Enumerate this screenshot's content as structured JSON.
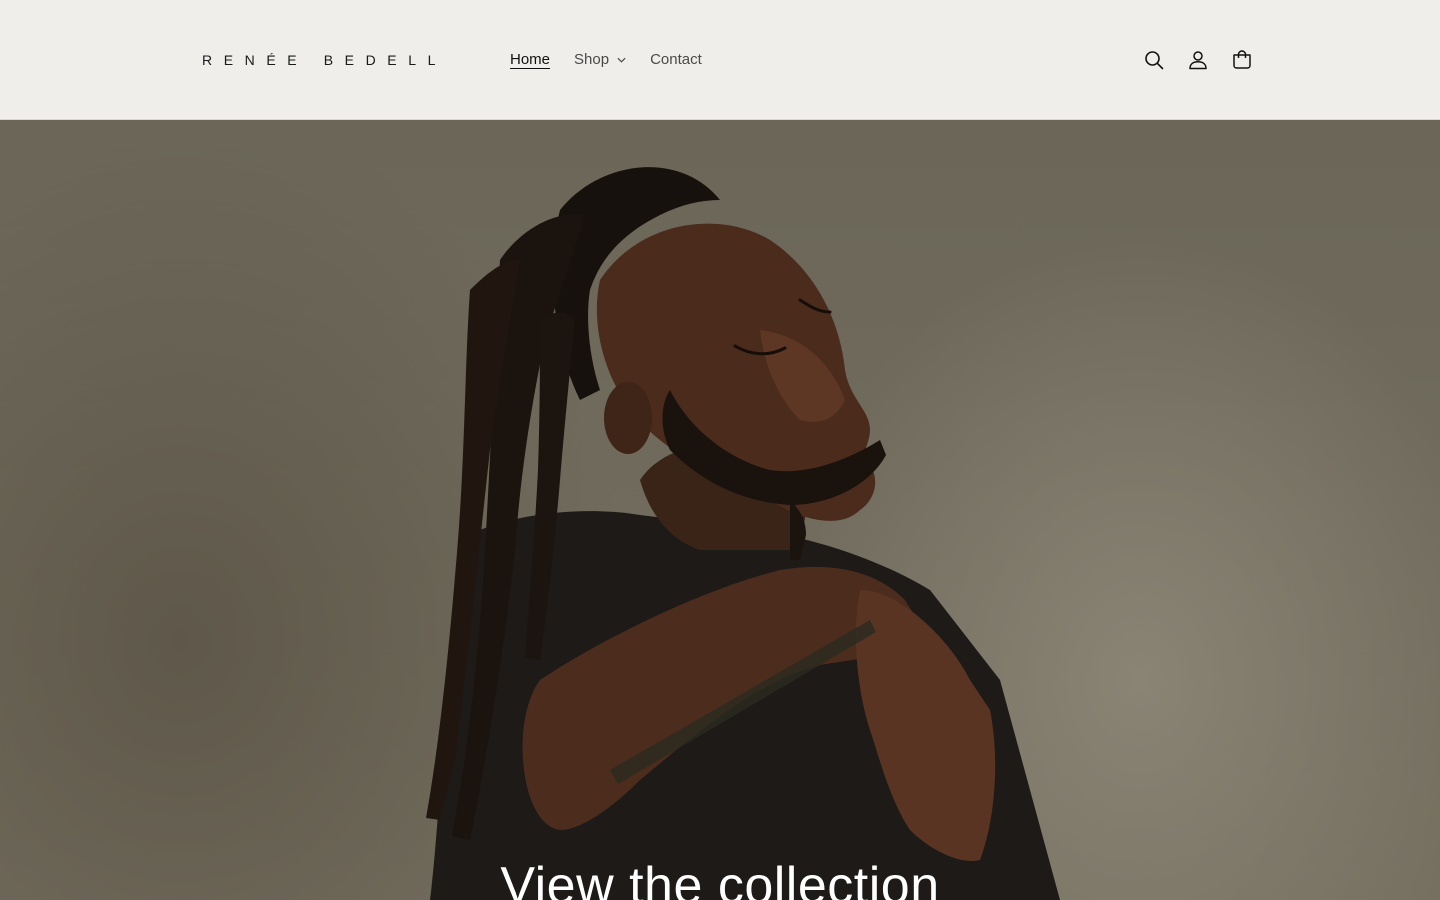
{
  "header": {
    "logo_text": "RENÉE BEDELL",
    "nav": [
      {
        "label": "Home",
        "active": true
      },
      {
        "label": "Shop",
        "has_dropdown": true
      },
      {
        "label": "Contact"
      }
    ],
    "icons": [
      "search-icon",
      "account-icon",
      "cart-icon"
    ]
  },
  "hero": {
    "heading": "View the collection",
    "image": "portrait of a man with long locs, eyes closed, wearing a dark t-shirt"
  },
  "colors": {
    "header_bg": "#efeeea",
    "text": "#121212",
    "hero_text": "#ffffff"
  }
}
